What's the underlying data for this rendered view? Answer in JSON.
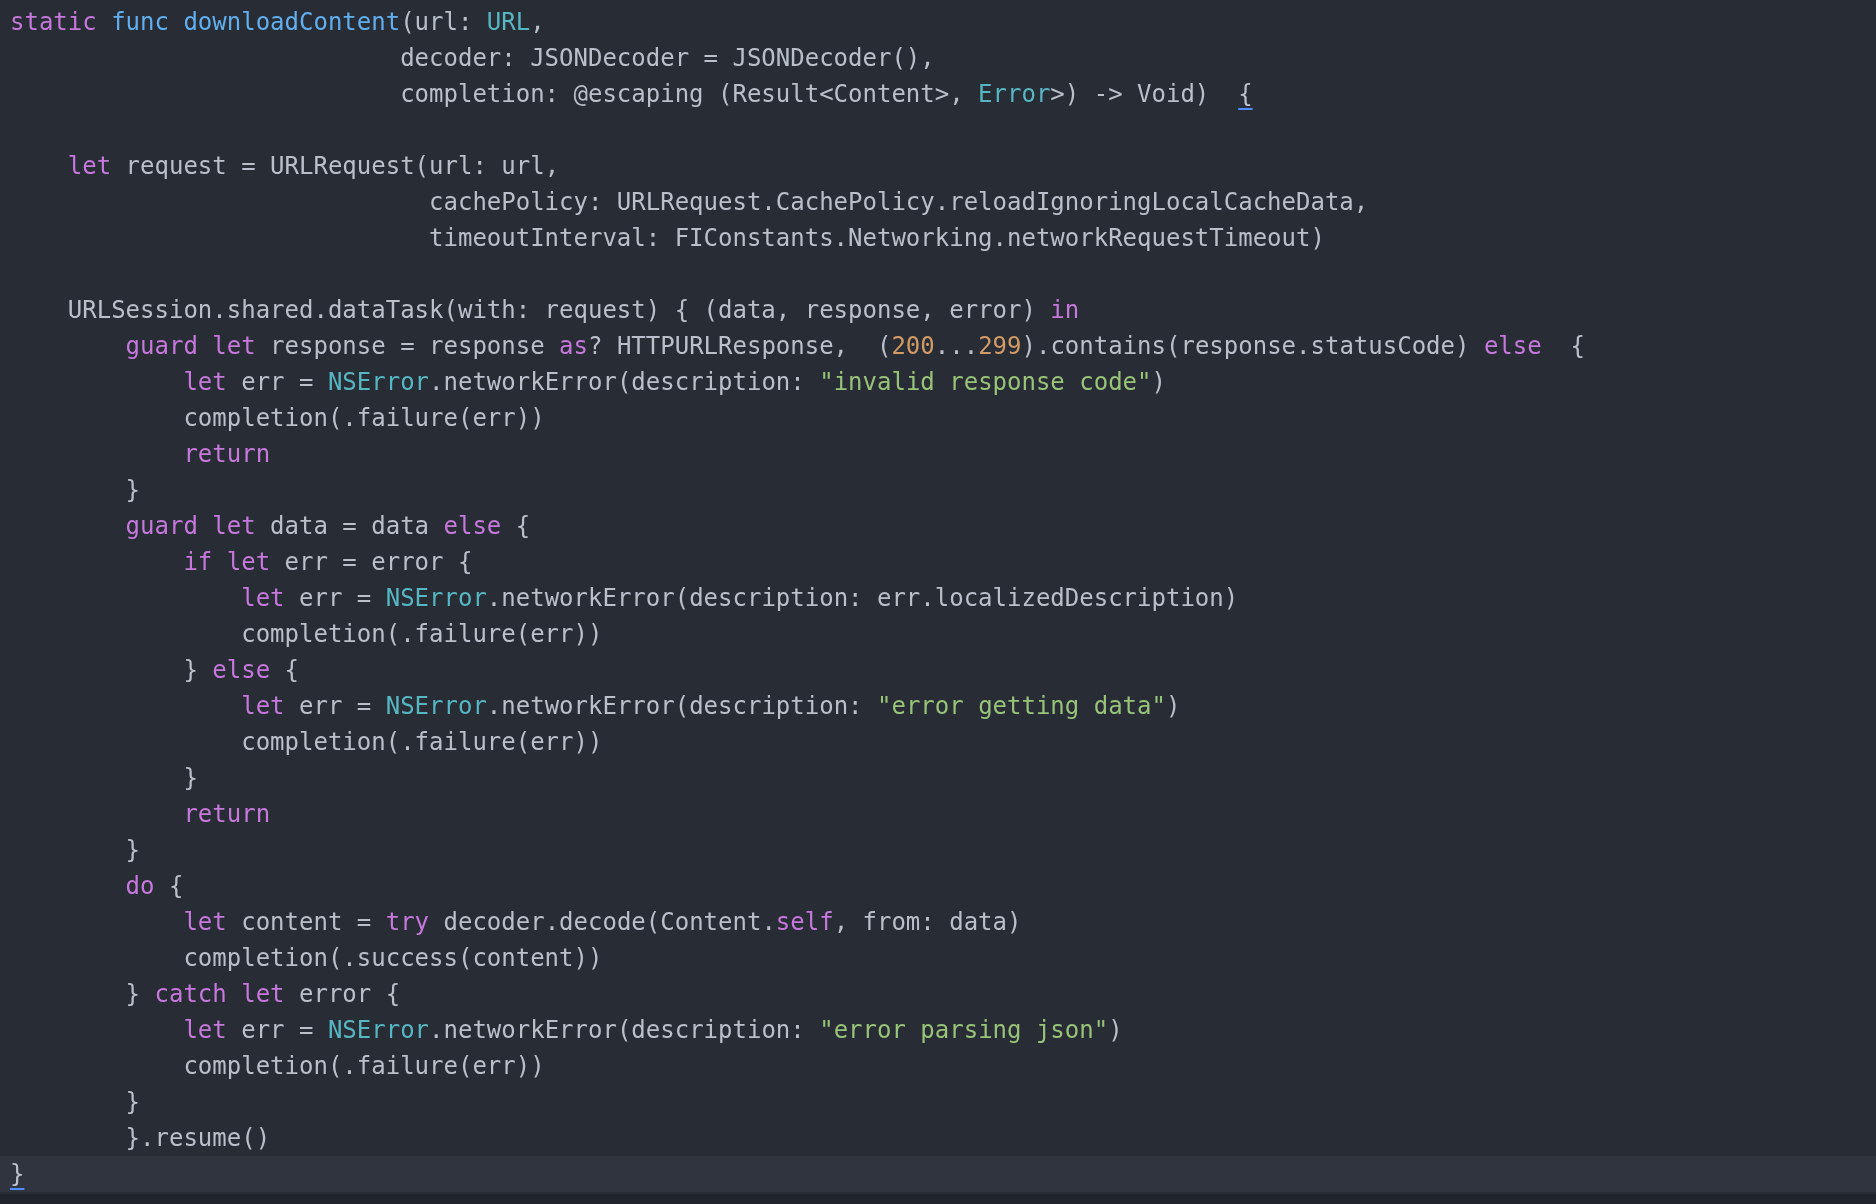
{
  "editor": {
    "lines": [
      {
        "kind": "code",
        "tokens": [
          {
            "kind": "kw",
            "text": "static"
          },
          {
            "kind": "fn",
            "text": " func"
          },
          {
            "kind": "fn",
            "text": " downloadContent"
          },
          {
            "kind": "plain",
            "text": "(url:"
          },
          {
            "kind": "type",
            "text": " URL"
          },
          {
            "kind": "plain",
            "text": ","
          }
        ]
      },
      {
        "kind": "code",
        "tokens": [
          {
            "kind": "plain",
            "text": "                           decoder: JSONDecoder = JSONDecoder(),"
          }
        ]
      },
      {
        "kind": "code",
        "tokens": [
          {
            "kind": "plain",
            "text": "                           completion: @escaping (Result<Content>,"
          },
          {
            "kind": "type",
            "text": " Error"
          },
          {
            "kind": "plain",
            "text": ">) -> Void)  "
          },
          {
            "kind": "plain",
            "text": "{",
            "match": true
          }
        ]
      },
      {
        "kind": "blank"
      },
      {
        "kind": "code",
        "tokens": [
          {
            "kind": "kw",
            "text": "    let"
          },
          {
            "kind": "plain",
            "text": " request = URLRequest(url: url,"
          }
        ]
      },
      {
        "kind": "code",
        "tokens": [
          {
            "kind": "plain",
            "text": "                             cachePolicy: URLRequest.CachePolicy.reloadIgnoringLocalCacheData,"
          }
        ]
      },
      {
        "kind": "code",
        "tokens": [
          {
            "kind": "plain",
            "text": "                             timeoutInterval: FIConstants.Networking.networkRequestTimeout)"
          }
        ]
      },
      {
        "kind": "blank"
      },
      {
        "kind": "code",
        "tokens": [
          {
            "kind": "plain",
            "text": "    URLSession.shared.dataTask(with: request) { (data, response, error)"
          },
          {
            "kind": "kw",
            "text": " in"
          }
        ]
      },
      {
        "kind": "code",
        "tokens": [
          {
            "kind": "kw",
            "text": "        guard"
          },
          {
            "kind": "kw",
            "text": " let"
          },
          {
            "kind": "plain",
            "text": " response = response"
          },
          {
            "kind": "kw",
            "text": " as"
          },
          {
            "kind": "plain",
            "text": "? HTTPURLResponse,  ("
          },
          {
            "kind": "num",
            "text": "200"
          },
          {
            "kind": "plain",
            "text": "..."
          },
          {
            "kind": "num",
            "text": "299"
          },
          {
            "kind": "plain",
            "text": ").contains(response.statusCode)"
          },
          {
            "kind": "kw",
            "text": " else"
          },
          {
            "kind": "plain",
            "text": "  {"
          }
        ]
      },
      {
        "kind": "code",
        "tokens": [
          {
            "kind": "kw",
            "text": "            let"
          },
          {
            "kind": "plain",
            "text": " err ="
          },
          {
            "kind": "type",
            "text": " NSError"
          },
          {
            "kind": "plain",
            "text": ".networkError(description:"
          },
          {
            "kind": "str",
            "text": " \"invalid response code\""
          },
          {
            "kind": "plain",
            "text": ")"
          }
        ]
      },
      {
        "kind": "code",
        "tokens": [
          {
            "kind": "plain",
            "text": "            completion(.failure(err))"
          }
        ]
      },
      {
        "kind": "code",
        "tokens": [
          {
            "kind": "kw",
            "text": "            return"
          }
        ]
      },
      {
        "kind": "code",
        "tokens": [
          {
            "kind": "plain",
            "text": "        }"
          }
        ]
      },
      {
        "kind": "code",
        "tokens": [
          {
            "kind": "kw",
            "text": "        guard"
          },
          {
            "kind": "kw",
            "text": " let"
          },
          {
            "kind": "plain",
            "text": " data = data"
          },
          {
            "kind": "kw",
            "text": " else"
          },
          {
            "kind": "plain",
            "text": " {"
          }
        ]
      },
      {
        "kind": "code",
        "tokens": [
          {
            "kind": "kw",
            "text": "            if"
          },
          {
            "kind": "kw",
            "text": " let"
          },
          {
            "kind": "plain",
            "text": " err = error {"
          }
        ]
      },
      {
        "kind": "code",
        "tokens": [
          {
            "kind": "kw",
            "text": "                let"
          },
          {
            "kind": "plain",
            "text": " err ="
          },
          {
            "kind": "type",
            "text": " NSError"
          },
          {
            "kind": "plain",
            "text": ".networkError(description: err.localizedDescription)"
          }
        ]
      },
      {
        "kind": "code",
        "tokens": [
          {
            "kind": "plain",
            "text": "                completion(.failure(err))"
          }
        ]
      },
      {
        "kind": "code",
        "tokens": [
          {
            "kind": "plain",
            "text": "            }"
          },
          {
            "kind": "kw",
            "text": " else"
          },
          {
            "kind": "plain",
            "text": " {"
          }
        ]
      },
      {
        "kind": "code",
        "tokens": [
          {
            "kind": "kw",
            "text": "                let"
          },
          {
            "kind": "plain",
            "text": " err ="
          },
          {
            "kind": "type",
            "text": " NSError"
          },
          {
            "kind": "plain",
            "text": ".networkError(description:"
          },
          {
            "kind": "str",
            "text": " \"error getting data\""
          },
          {
            "kind": "plain",
            "text": ")"
          }
        ]
      },
      {
        "kind": "code",
        "tokens": [
          {
            "kind": "plain",
            "text": "                completion(.failure(err))"
          }
        ]
      },
      {
        "kind": "code",
        "tokens": [
          {
            "kind": "plain",
            "text": "            }"
          }
        ]
      },
      {
        "kind": "code",
        "tokens": [
          {
            "kind": "kw",
            "text": "            return"
          }
        ]
      },
      {
        "kind": "code",
        "tokens": [
          {
            "kind": "plain",
            "text": "        }"
          }
        ]
      },
      {
        "kind": "code",
        "tokens": [
          {
            "kind": "kw",
            "text": "        do"
          },
          {
            "kind": "plain",
            "text": " {"
          }
        ]
      },
      {
        "kind": "code",
        "tokens": [
          {
            "kind": "kw",
            "text": "            let"
          },
          {
            "kind": "plain",
            "text": " content ="
          },
          {
            "kind": "kw",
            "text": " try"
          },
          {
            "kind": "plain",
            "text": " decoder.decode(Content."
          },
          {
            "kind": "kw",
            "text": "self"
          },
          {
            "kind": "plain",
            "text": ", from: data)"
          }
        ]
      },
      {
        "kind": "code",
        "tokens": [
          {
            "kind": "plain",
            "text": "            completion(.success(content))"
          }
        ]
      },
      {
        "kind": "code",
        "tokens": [
          {
            "kind": "plain",
            "text": "        }"
          },
          {
            "kind": "kw",
            "text": " catch"
          },
          {
            "kind": "kw",
            "text": " let"
          },
          {
            "kind": "plain",
            "text": " error {"
          }
        ]
      },
      {
        "kind": "code",
        "tokens": [
          {
            "kind": "kw",
            "text": "            let"
          },
          {
            "kind": "plain",
            "text": " err ="
          },
          {
            "kind": "type",
            "text": " NSError"
          },
          {
            "kind": "plain",
            "text": ".networkError(description:"
          },
          {
            "kind": "str",
            "text": " \"error parsing json\""
          },
          {
            "kind": "plain",
            "text": ")"
          }
        ]
      },
      {
        "kind": "code",
        "tokens": [
          {
            "kind": "plain",
            "text": "            completion(.failure(err))"
          }
        ]
      },
      {
        "kind": "code",
        "tokens": [
          {
            "kind": "plain",
            "text": "        }"
          }
        ]
      },
      {
        "kind": "code",
        "tokens": [
          {
            "kind": "plain",
            "text": "        }.resume()"
          }
        ]
      },
      {
        "kind": "code",
        "current": true,
        "tokens": [
          {
            "kind": "plain",
            "text": "}",
            "match": true
          }
        ]
      }
    ]
  }
}
